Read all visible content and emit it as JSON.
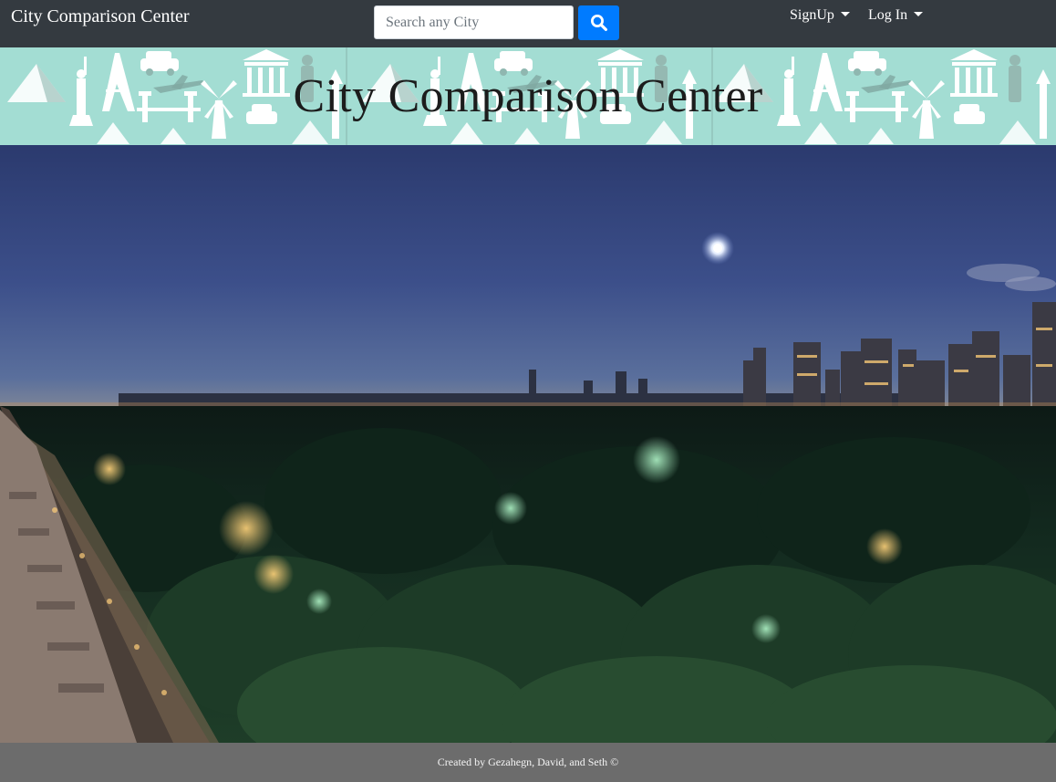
{
  "navbar": {
    "brand": "City Comparison Center",
    "search": {
      "placeholder": "Search any City",
      "value": "",
      "button_icon": "search-icon"
    },
    "menus": [
      {
        "label": "SignUp",
        "icon": "caret-down-icon"
      },
      {
        "label": "Log In",
        "icon": "caret-down-icon"
      }
    ]
  },
  "banner": {
    "title": "City Comparison Center",
    "background_color": "#a3ddd3"
  },
  "hero": {
    "image": "night-city-skyline-over-park-photo"
  },
  "footer": {
    "text": "Created by Gezahegn, David, and Seth ©"
  },
  "colors": {
    "navbar": "#343a40",
    "search_button": "#007bff",
    "footer": "#6c6c6c"
  }
}
